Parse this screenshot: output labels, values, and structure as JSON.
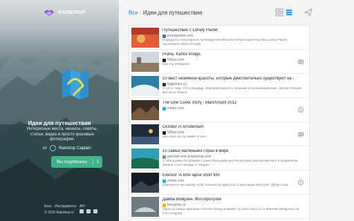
{
  "brand": {
    "name": "RAINDROP",
    "sub": "IO"
  },
  "collection": {
    "title": "Идеи для путешествия",
    "description": "Интересные места, нюансы, советы, статьи, видео и просто красивые фотографии.",
    "owner_prefix": "от",
    "owner_name": "Raindrop Captain"
  },
  "subscribe": {
    "label": "Вы подписаны",
    "count": "1"
  },
  "footer": {
    "links": "Блог · Инструменты · API",
    "copyright": "© 2015 Raindrop.io"
  },
  "breadcrumb": {
    "root": "Все",
    "separator": " · ",
    "current": "Идеи для путешествия"
  },
  "items": [
    {
      "title": "Путешествие с Lonely Planet",
      "domain": "lonelyplanet.com",
      "desc": "Маршруты популярного путеводителя Beautiful World издательства Lonely Planet проложили через Google",
      "type": "article"
    },
    {
      "title": "Praha, Karlov bridge.",
      "domain": "500px.com",
      "desc": "See my Instagram",
      "type": "image"
    },
    {
      "title": "10 мест неземной красоты, которые действительно существуют на Земле",
      "domain": "bigpicture.ru",
      "desc": "Я это к тому что и вправду, неземной красоты пейзажи и необыкновенные, впечатляющие места на Земле",
      "type": "article"
    },
    {
      "title": "The One Cover Story - March/April 2012",
      "domain": "vimeo.com",
      "desc": "",
      "type": "video"
    },
    {
      "title": "October in Amsterdam",
      "domain": "500px.com",
      "desc": "see more on my twitter in see...",
      "type": "image"
    },
    {
      "title": "10 самых маленьких стран в мире",
      "domain": "parynok-mini.livejournal.com",
      "desc": "1. Мальдивы Островная страна Мальдивская Республика расположилась в Индийском океане к юго-западу от Индии.",
      "type": "article"
    },
    {
      "title": "Everest -A time lapse short film",
      "domain": "vimeo.com",
      "desc": "Experience the beauty of Mt. Everest at night from a time lapse short film. White most...",
      "type": "video"
    },
    {
      "title": "Дамба Мовузен. Фотопрогулки",
      "domain": "funnyfoto.ru",
      "desc": "Одна из самых красивых плотин Гранд Комбинт (Contra Dam) и La Rurrette (Мовузен) на Сан (Sagnee...",
      "type": "article"
    }
  ],
  "colors": {
    "accent": "#2f8fd1",
    "subscribe": "#41b48a"
  }
}
